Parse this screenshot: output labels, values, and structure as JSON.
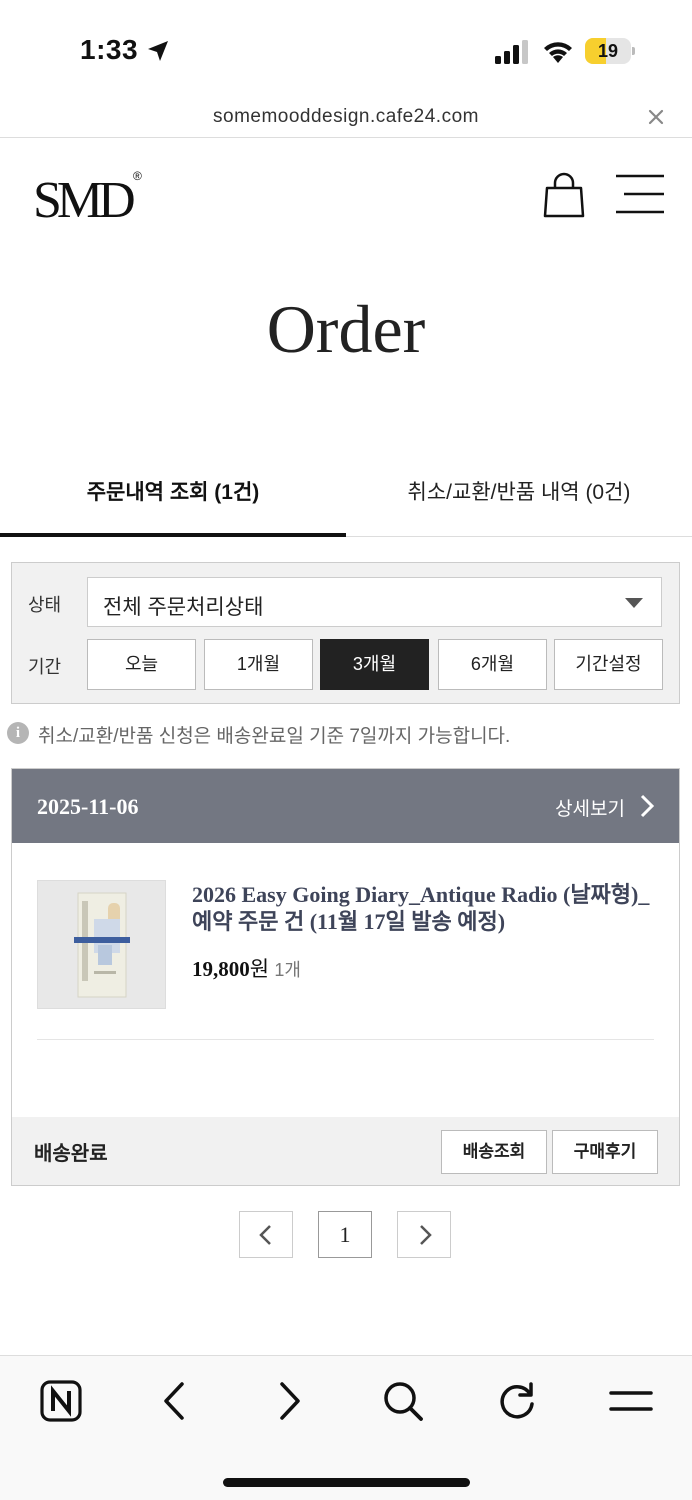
{
  "status_bar": {
    "time": "1:33",
    "battery_level": "19",
    "battery_fraction": 0.19
  },
  "browser": {
    "url": "somemooddesign.cafe24.com"
  },
  "header": {
    "logo": "SMD",
    "logo_mark": "®"
  },
  "page": {
    "title": "Order"
  },
  "tabs": [
    {
      "label": "주문내역 조회 (1건)",
      "active": true
    },
    {
      "label": "취소/교환/반품 내역 (0건)",
      "active": false
    }
  ],
  "filter": {
    "status_label": "상태",
    "status_value": "전체 주문처리상태",
    "period_label": "기간",
    "periods": [
      {
        "label": "오늘",
        "selected": false
      },
      {
        "label": "1개월",
        "selected": false
      },
      {
        "label": "3개월",
        "selected": true
      },
      {
        "label": "6개월",
        "selected": false
      },
      {
        "label": "기간설정",
        "selected": false
      }
    ]
  },
  "notice": {
    "icon_text": "i",
    "text": "취소/교환/반품 신청은 배송완료일 기준 7일까지 가능합니다."
  },
  "order": {
    "date": "2025-11-06",
    "detail_link": "상세보기",
    "product": {
      "name": "2026 Easy Going Diary_Antique Radio (날짜형)_ 예약 주문 건 (11월 17일 발송 예정)",
      "price": "19,800",
      "currency": "원",
      "quantity": "1개"
    },
    "status": "배송완료",
    "actions": [
      "배송조회",
      "구매후기"
    ]
  },
  "pagination": {
    "current": "1"
  },
  "colors": {
    "order_header_bg": "#737782",
    "selected_period_bg": "#222222",
    "product_name": "#3e4459",
    "battery": "#f7cf2e"
  },
  "icons": [
    "location-arrow-icon",
    "signal-icon",
    "wifi-icon",
    "close-icon",
    "cart-icon",
    "menu-icon",
    "chevron-down-icon",
    "chevron-right-icon",
    "naver-icon",
    "back-icon",
    "forward-icon",
    "search-icon",
    "reload-icon"
  ]
}
